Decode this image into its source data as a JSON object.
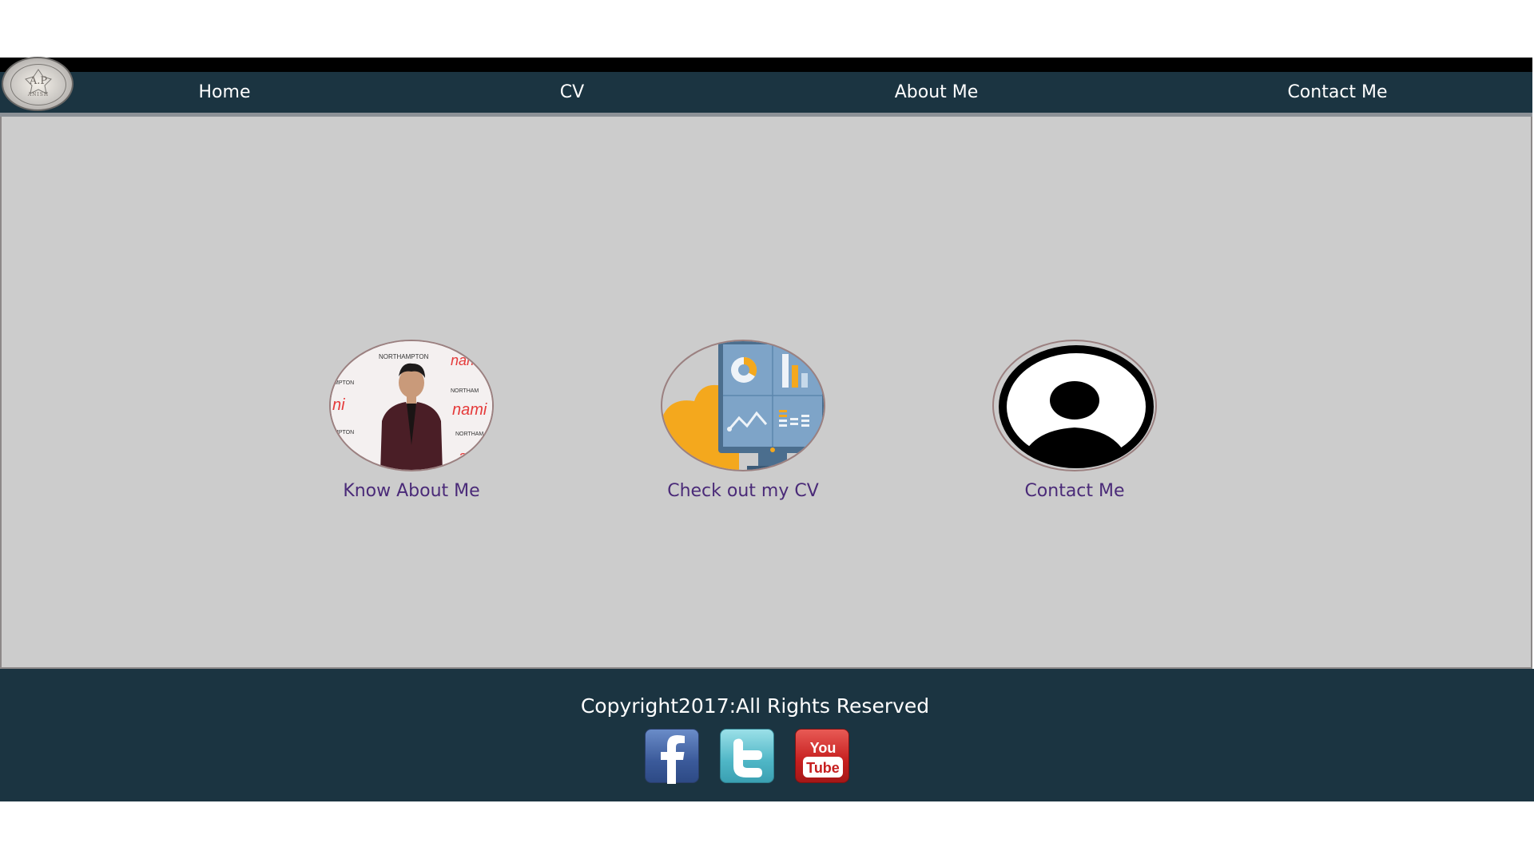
{
  "nav": {
    "logo": {
      "monogram": "A.P",
      "subtitle": "ANISH"
    },
    "items": [
      {
        "label": "Home"
      },
      {
        "label": "CV"
      },
      {
        "label": "About Me"
      },
      {
        "label": "Contact Me"
      }
    ]
  },
  "cards": [
    {
      "label": "Know About Me",
      "image": "profile-photo"
    },
    {
      "label": "Check out my CV",
      "image": "dashboard-illustration"
    },
    {
      "label": "Contact Me",
      "image": "user-avatar-icon"
    }
  ],
  "footer": {
    "copyright": "Copyright2017:All Rights Reserved",
    "social": [
      {
        "name": "facebook-icon",
        "color": "#3b5a9a"
      },
      {
        "name": "twitter-icon",
        "color": "#4fb6c6"
      },
      {
        "name": "youtube-icon",
        "color": "#c61f1f"
      }
    ]
  },
  "colors": {
    "nav_background": "#1b3441",
    "main_background": "#cccccc",
    "link_color": "#4a2a78"
  }
}
